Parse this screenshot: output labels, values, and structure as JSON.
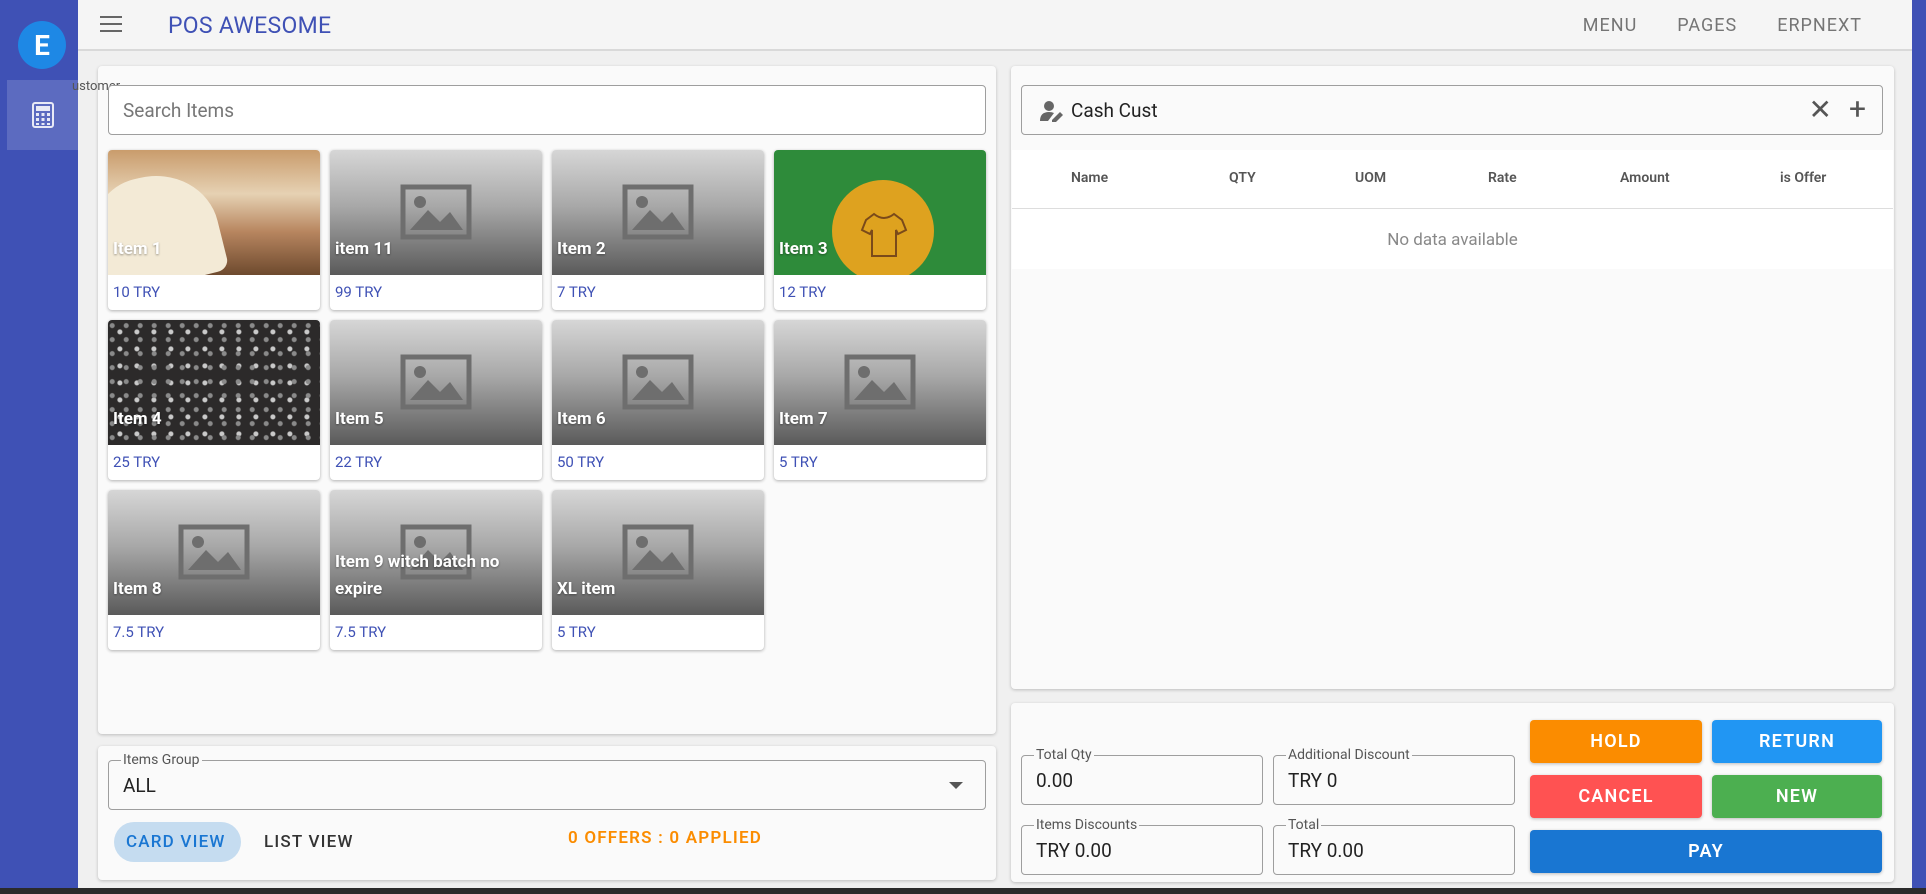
{
  "app": {
    "title_part1": "POS",
    "title_part2": "AWESOME",
    "logo_letter": "E"
  },
  "topnav": [
    {
      "label": "MENU"
    },
    {
      "label": "PAGES"
    },
    {
      "label": "ERPNEXT"
    }
  ],
  "stray_label": "ustomer",
  "search": {
    "placeholder": "Search Items",
    "value": ""
  },
  "items": [
    {
      "name": "Item 1",
      "price": "10 TRY",
      "image": "bread"
    },
    {
      "name": "item 11",
      "price": "99 TRY",
      "image": "placeholder"
    },
    {
      "name": "Item 2",
      "price": "7 TRY",
      "image": "placeholder"
    },
    {
      "name": "Item 3",
      "price": "12 TRY",
      "image": "product-labels"
    },
    {
      "name": "Item 4",
      "price": "25 TRY",
      "image": "dress"
    },
    {
      "name": "Item 5",
      "price": "22 TRY",
      "image": "placeholder"
    },
    {
      "name": "Item 6",
      "price": "50 TRY",
      "image": "placeholder"
    },
    {
      "name": "Item 7",
      "price": "5 TRY",
      "image": "placeholder"
    },
    {
      "name": "Item 8",
      "price": "7.5 TRY",
      "image": "placeholder"
    },
    {
      "name": "Item 9 witch batch no expire",
      "price": "7.5 TRY",
      "image": "placeholder"
    },
    {
      "name": "XL item",
      "price": "5 TRY",
      "image": "placeholder"
    }
  ],
  "items_group": {
    "label": "Items Group",
    "value": "ALL"
  },
  "views": {
    "card": "CARD VIEW",
    "list": "LIST VIEW"
  },
  "offers": "0 OFFERS : 0 APPLIED",
  "customer": {
    "value": "Cash Cust"
  },
  "invoice_table": {
    "headers": [
      "Name",
      "QTY",
      "UOM",
      "Rate",
      "Amount",
      "is Offer"
    ],
    "empty_text": "No data available"
  },
  "totals": {
    "total_qty": {
      "label": "Total Qty",
      "value": "0.00"
    },
    "additional_discount": {
      "label": "Additional Discount",
      "value": "TRY 0"
    },
    "items_discounts": {
      "label": "Items Discounts",
      "value": "TRY 0.00"
    },
    "total": {
      "label": "Total",
      "value": "TRY 0.00"
    }
  },
  "actions": {
    "hold": "HOLD",
    "return": "RETURN",
    "cancel": "CANCEL",
    "new": "NEW",
    "pay": "PAY"
  },
  "colors": {
    "primary": "#3f51b5",
    "hold": "#fb8c00",
    "return": "#2196f3",
    "cancel": "#ff5252",
    "new": "#4caf50",
    "pay": "#1976d2"
  }
}
